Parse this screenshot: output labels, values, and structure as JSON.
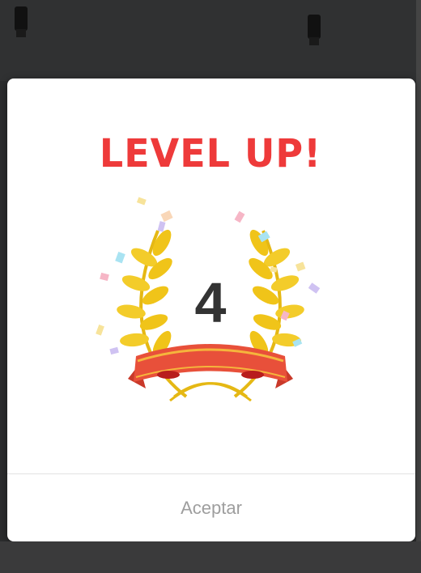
{
  "dialog": {
    "title": "LEVEL UP!",
    "level": "4",
    "accept_label": "Aceptar"
  },
  "colors": {
    "title": "#ee3a3a",
    "level": "#333333",
    "laurel": "#f0c419",
    "ribbon": "#e8503a",
    "ribbon_stripe": "#f5b53c",
    "button_text": "#9e9e9e"
  },
  "icons": [
    "laurel-wreath-icon",
    "ribbon-banner-icon",
    "confetti-icon",
    "ceiling-light-icon"
  ]
}
